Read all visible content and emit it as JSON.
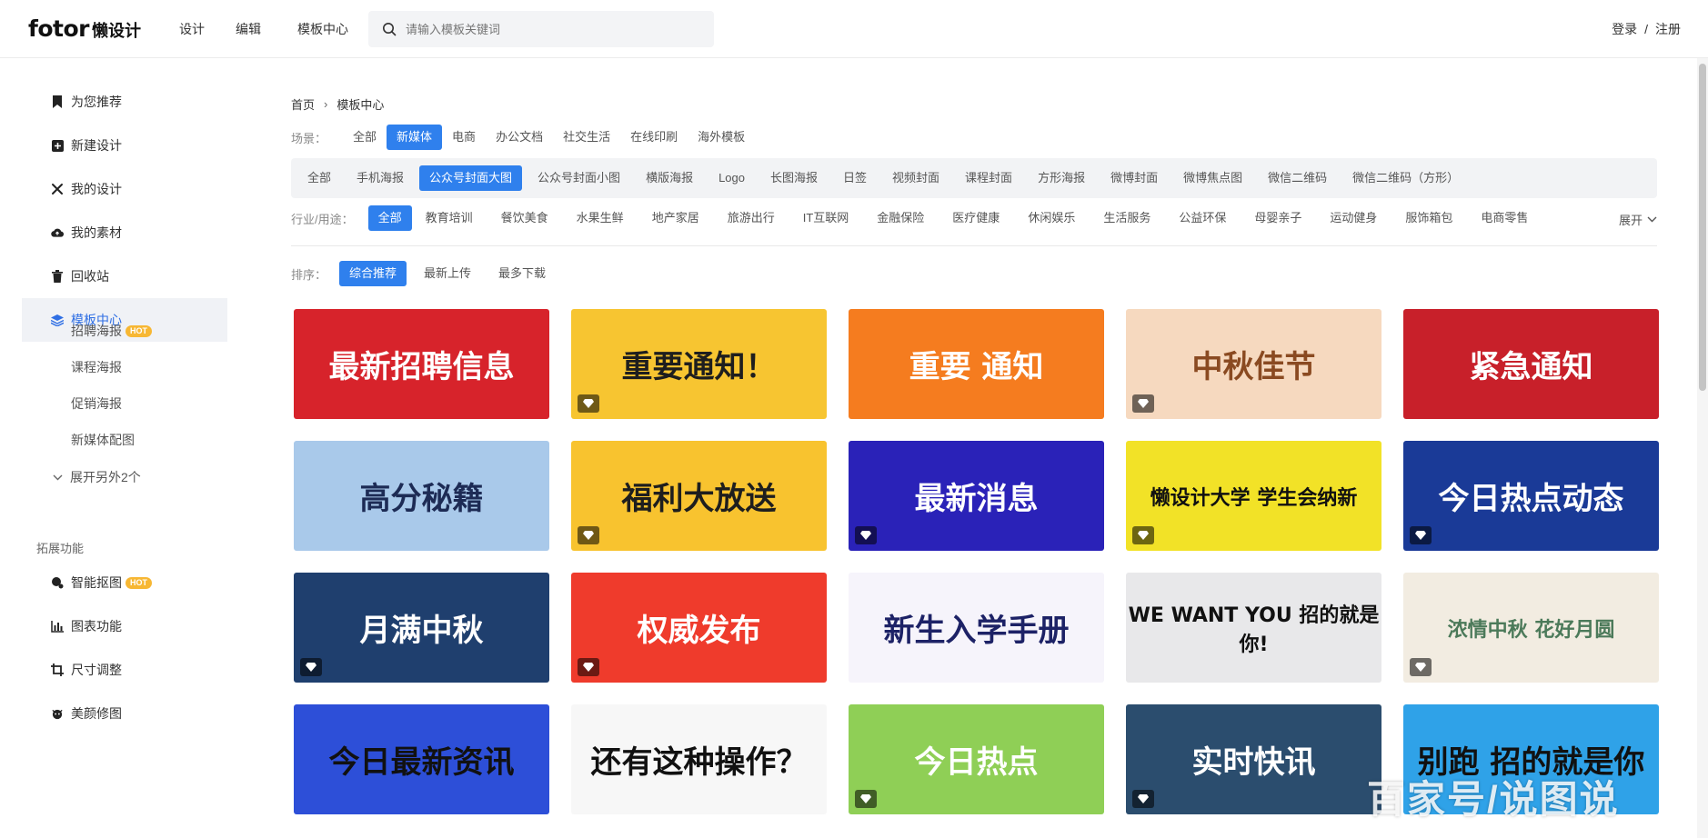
{
  "header": {
    "logo_brand": "fotor",
    "logo_sub": "懒设计",
    "nav": [
      "设计",
      "编辑",
      "模板中心"
    ],
    "search_placeholder": "请输入模板关键词",
    "login": "登录",
    "sep": "/",
    "register": "注册"
  },
  "sidebar": {
    "items": [
      {
        "label": "为您推荐"
      },
      {
        "label": "新建设计"
      },
      {
        "label": "我的设计"
      },
      {
        "label": "我的素材"
      },
      {
        "label": "回收站"
      },
      {
        "label": "模板中心"
      }
    ],
    "sub_items": [
      "招聘海报",
      "课程海报",
      "促销海报",
      "新媒体配图"
    ],
    "hot_badge": "HOT",
    "expand_more": "展开另外2个",
    "ext_label": "拓展功能",
    "ext_items": [
      "智能抠图",
      "图表功能",
      "尺寸调整",
      "美颜修图"
    ]
  },
  "main": {
    "breadcrumb": [
      "首页",
      "模板中心"
    ],
    "scene_label": "场景：",
    "scenes": [
      "全部",
      "新媒体",
      "电商",
      "办公文档",
      "社交生活",
      "在线印刷",
      "海外模板"
    ],
    "formats": [
      "全部",
      "手机海报",
      "公众号封面大图",
      "公众号封面小图",
      "横版海报",
      "Logo",
      "长图海报",
      "日签",
      "视频封面",
      "课程封面",
      "方形海报",
      "微博封面",
      "微博焦点图",
      "微信二维码",
      "微信二维码（方形）"
    ],
    "industry_label": "行业/用途：",
    "industries": [
      "全部",
      "教育培训",
      "餐饮美食",
      "水果生鲜",
      "地产家居",
      "旅游出行",
      "IT互联网",
      "金融保险",
      "医疗健康",
      "休闲娱乐",
      "生活服务",
      "公益环保",
      "母婴亲子",
      "运动健身",
      "服饰箱包",
      "电商零售"
    ],
    "expand": "展开",
    "sort_label": "排序：",
    "sorts": [
      "综合推荐",
      "最新上传",
      "最多下载"
    ]
  },
  "templates": [
    {
      "title": "最新招聘信息",
      "bg": "#d7232b",
      "fg": "#ffffff"
    },
    {
      "title": "重要通知！",
      "bg": "#f7c531",
      "fg": "#1e1e1e"
    },
    {
      "title": "重要 通知",
      "bg": "#f57c1f",
      "fg": "#ffffff"
    },
    {
      "title": "中秋佳节",
      "bg": "#f6d9bf",
      "fg": "#8a4a21"
    },
    {
      "title": "紧急通知",
      "bg": "#c8202a",
      "fg": "#ffffff"
    },
    {
      "title": "高分秘籍",
      "bg": "#a9c9ea",
      "fg": "#1d2b55"
    },
    {
      "title": "福利大放送",
      "bg": "#f8c32f",
      "fg": "#1e1e1e"
    },
    {
      "title": "最新消息",
      "bg": "#2a22b8",
      "fg": "#ffffff"
    },
    {
      "title": "懒设计大学 学生会纳新",
      "bg": "#f2e227",
      "fg": "#111111"
    },
    {
      "title": "今日热点动态",
      "bg": "#1a3a97",
      "fg": "#ffffff"
    },
    {
      "title": "月满中秋",
      "bg": "#1f3f6e",
      "fg": "#ffffff"
    },
    {
      "title": "权威发布",
      "bg": "#ef3b2c",
      "fg": "#ffffff"
    },
    {
      "title": "新生入学手册",
      "bg": "#f6f4fb",
      "fg": "#1d2266"
    },
    {
      "title": "WE WANT YOU 招的就是你!",
      "bg": "#e8e8ea",
      "fg": "#111111"
    },
    {
      "title": "浓情中秋 花好月圆",
      "bg": "#f2ece1",
      "fg": "#4c7a5a"
    },
    {
      "title": "今日最新资讯",
      "bg": "#2d4fd8",
      "fg": "#111111"
    },
    {
      "title": "还有这种操作？",
      "bg": "#f7f7f7",
      "fg": "#111111"
    },
    {
      "title": "今日热点",
      "bg": "#8fcf56",
      "fg": "#ffffff"
    },
    {
      "title": "实时快讯",
      "bg": "#2b4d6e",
      "fg": "#ffffff"
    },
    {
      "title": "别跑 招的就是你",
      "bg": "#2fa2e8",
      "fg": "#111111"
    }
  ],
  "watermark": "百家号/说图说"
}
